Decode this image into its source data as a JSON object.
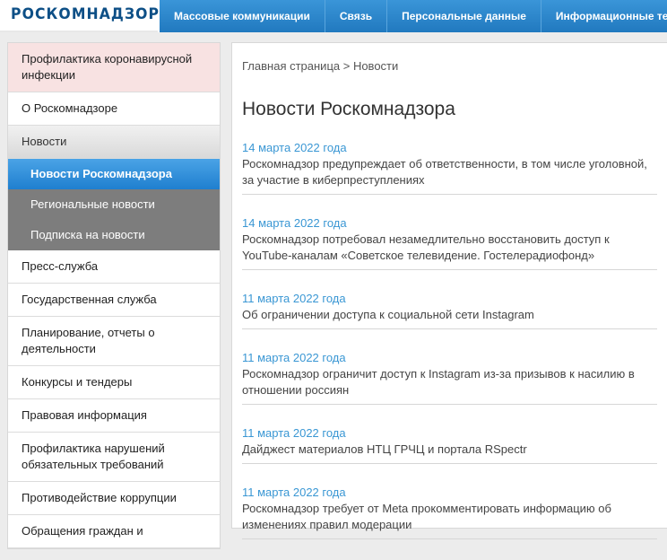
{
  "header": {
    "logo": "РОСКОМНАДЗОР",
    "nav": [
      "Массовые коммуникации",
      "Связь",
      "Персональные данные",
      "Информационные тех"
    ]
  },
  "sidebar": {
    "items": [
      {
        "label": "Профилактика коронавирусной инфекции"
      },
      {
        "label": "О Роскомнадзоре"
      },
      {
        "label": "Новости"
      },
      {
        "label": "Пресс-служба"
      },
      {
        "label": "Государственная служба"
      },
      {
        "label": "Планирование, отчеты о деятельности"
      },
      {
        "label": "Конкурсы и тендеры"
      },
      {
        "label": "Правовая информация"
      },
      {
        "label": "Профилактика нарушений обязательных требований"
      },
      {
        "label": "Противодействие коррупции"
      },
      {
        "label": "Обращения граждан и"
      }
    ],
    "subitems": [
      {
        "label": "Новости Роскомнадзора"
      },
      {
        "label": "Региональные новости"
      },
      {
        "label": "Подписка на новости"
      }
    ]
  },
  "main": {
    "breadcrumb": "Главная страница > Новости",
    "title": "Новости Роскомнадзора",
    "news": [
      {
        "date": "14 марта 2022 года",
        "title": "Роскомнадзор предупреждает об ответственности, в том числе уголовной, за участие в киберпреступлениях"
      },
      {
        "date": "14 марта 2022 года",
        "title": "Роскомнадзор потребовал незамедлительно восстановить доступ к YouTube-каналам «Советское телевидение. Гостелерадиофонд»"
      },
      {
        "date": "11 марта 2022 года",
        "title": "Об ограничении доступа к социальной сети Instagram"
      },
      {
        "date": "11 марта 2022 года",
        "title": "Роскомнадзор ограничит доступ к Instagram из-за призывов к насилию в отношении россиян"
      },
      {
        "date": "11 марта 2022 года",
        "title": "Дайджест материалов НТЦ ГРЧЦ и портала RSpectr"
      },
      {
        "date": "11 марта 2022 года",
        "title": "Роскомнадзор требует от Meta прокомментировать информацию об изменениях правил модерации"
      }
    ]
  },
  "colors": {
    "brand": "#0d4f86",
    "nav": "#2a86cc",
    "link": "#3a97d4",
    "highlight": "#f8e2e2",
    "submenu": "#7d7d7d"
  }
}
